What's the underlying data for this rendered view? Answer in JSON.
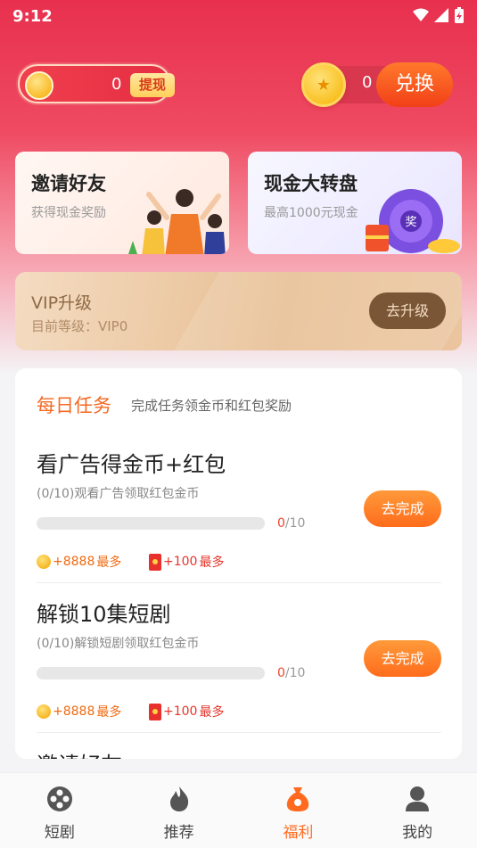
{
  "status": {
    "time": "9:12"
  },
  "header": {
    "cash_value": "0",
    "withdraw_label": "提现",
    "coin_value": "0",
    "exchange_label": "兑换"
  },
  "promos": [
    {
      "title": "邀请好友",
      "subtitle": "获得现金奖励"
    },
    {
      "title": "现金大转盘",
      "subtitle": "最高1000元现金"
    }
  ],
  "vip": {
    "title": "VIP升级",
    "level": "目前等级：VIP0",
    "button": "去升级"
  },
  "tasks": {
    "title": "每日任务",
    "subtitle": "完成任务领金币和红包奖励",
    "items": [
      {
        "name": "看广告得金币+红包",
        "desc": "(0/10)观看广告领取红包金币",
        "progress_current": "0",
        "progress_total": "/10",
        "progress_fraction": 0,
        "button": "去完成",
        "coin_reward": "+8888",
        "coin_suffix": "最多",
        "red_reward": "+100",
        "red_suffix": "最多"
      },
      {
        "name": "解锁10集短剧",
        "desc": "(0/10)解锁短剧领取红包金币",
        "progress_current": "0",
        "progress_total": "/10",
        "progress_fraction": 0,
        "button": "去完成",
        "coin_reward": "+8888",
        "coin_suffix": "最多",
        "red_reward": "+100",
        "red_suffix": "最多"
      },
      {
        "name": "邀请好友"
      }
    ]
  },
  "tabbar": {
    "items": [
      {
        "label": "短剧",
        "icon": "film-reel-icon"
      },
      {
        "label": "推荐",
        "icon": "flame-icon"
      },
      {
        "label": "福利",
        "icon": "money-bag-icon"
      },
      {
        "label": "我的",
        "icon": "person-icon"
      }
    ],
    "active_index": 2,
    "active_color": "#ff6a1e"
  }
}
